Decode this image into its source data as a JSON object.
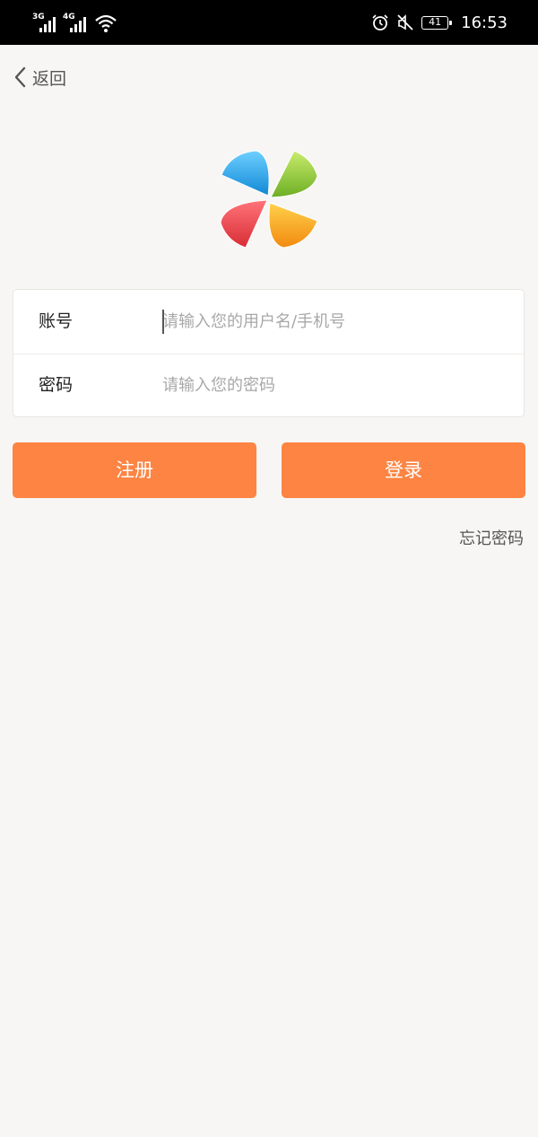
{
  "status_bar": {
    "network1": "3G",
    "network2": "4G",
    "battery": "41",
    "time": "16:53",
    "icons": [
      "signal-icon",
      "wifi-icon",
      "alarm-icon",
      "mute-icon",
      "battery-icon"
    ]
  },
  "nav": {
    "back_label": "返回",
    "back_icon": "chevron-left-icon"
  },
  "logo": {
    "icon": "pinwheel-logo",
    "colors": [
      "#1aa3e8",
      "#8cc63e",
      "#e8434b",
      "#f7a91c"
    ]
  },
  "form": {
    "account_label": "账号",
    "account_placeholder": "请输入您的用户名/手机号",
    "password_label": "密码",
    "password_placeholder": "请输入您的密码"
  },
  "actions": {
    "register_label": "注册",
    "login_label": "登录",
    "forgot_label": "忘记密码"
  },
  "theme": {
    "accent": "#fd8443",
    "background": "#f7f6f4"
  }
}
